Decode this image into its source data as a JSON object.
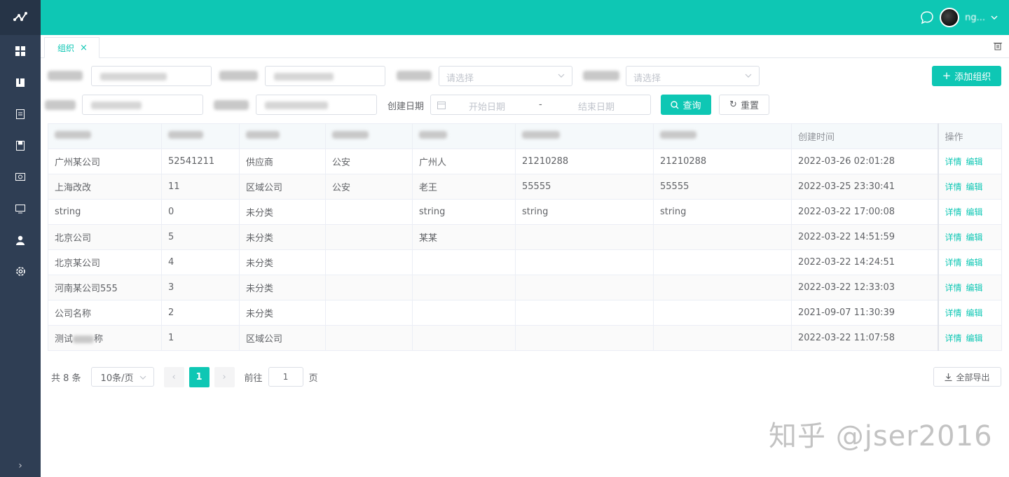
{
  "tab": {
    "label": "组织"
  },
  "filters": {
    "row1_select1_placeholder": "请选择",
    "row1_select2_placeholder": "请选择",
    "add_button": "添加组织",
    "date_label": "创建日期",
    "date_start": "开始日期",
    "date_sep": "-",
    "date_end": "结束日期",
    "query_button": "查询",
    "reset_button": "重置"
  },
  "table": {
    "headers": [
      "",
      "",
      "",
      "",
      "",
      "",
      "",
      "创建时间",
      "操作"
    ],
    "rows": [
      [
        "广州某公司",
        "52541211",
        "供应商",
        "公安",
        "广州人",
        "21210288",
        "21210288",
        "2022-03-26 02:01:28"
      ],
      [
        "上海改改",
        "11",
        "区域公司",
        "公安",
        "老王",
        "55555",
        "55555",
        "2022-03-25 23:30:41"
      ],
      [
        "string",
        "0",
        "未分类",
        "",
        "string",
        "string",
        "string",
        "2022-03-22 17:00:08"
      ],
      [
        "北京公司",
        "5",
        "未分类",
        "",
        "某某",
        "",
        "",
        "2022-03-22 14:51:59"
      ],
      [
        "北京某公司",
        "4",
        "未分类",
        "",
        "",
        "",
        "",
        "2022-03-22 14:24:51"
      ],
      [
        "河南某公司555",
        "3",
        "未分类",
        "",
        "",
        "",
        "",
        "2022-03-22 12:33:03"
      ],
      [
        "公司名称",
        "2",
        "未分类",
        "",
        "",
        "",
        "",
        "2021-09-07 11:30:39"
      ],
      [
        "测试",
        "1",
        "区域公司",
        "",
        "",
        "",
        "",
        "2022-03-22 11:07:58"
      ]
    ],
    "row8_suffix": "称",
    "op_detail": "详情",
    "op_edit": "编辑"
  },
  "pagination": {
    "total": "共 8 条",
    "page_size": "10条/页",
    "current_page": "1",
    "goto_label": "前往",
    "goto_value": "1",
    "goto_suffix": "页"
  },
  "export_button": "全部导出",
  "watermark": "知乎 @jser2016",
  "user": {
    "name": "ng..."
  },
  "colors": {
    "accent": "#0ec7b4",
    "sidebar": "#2f3e54"
  }
}
